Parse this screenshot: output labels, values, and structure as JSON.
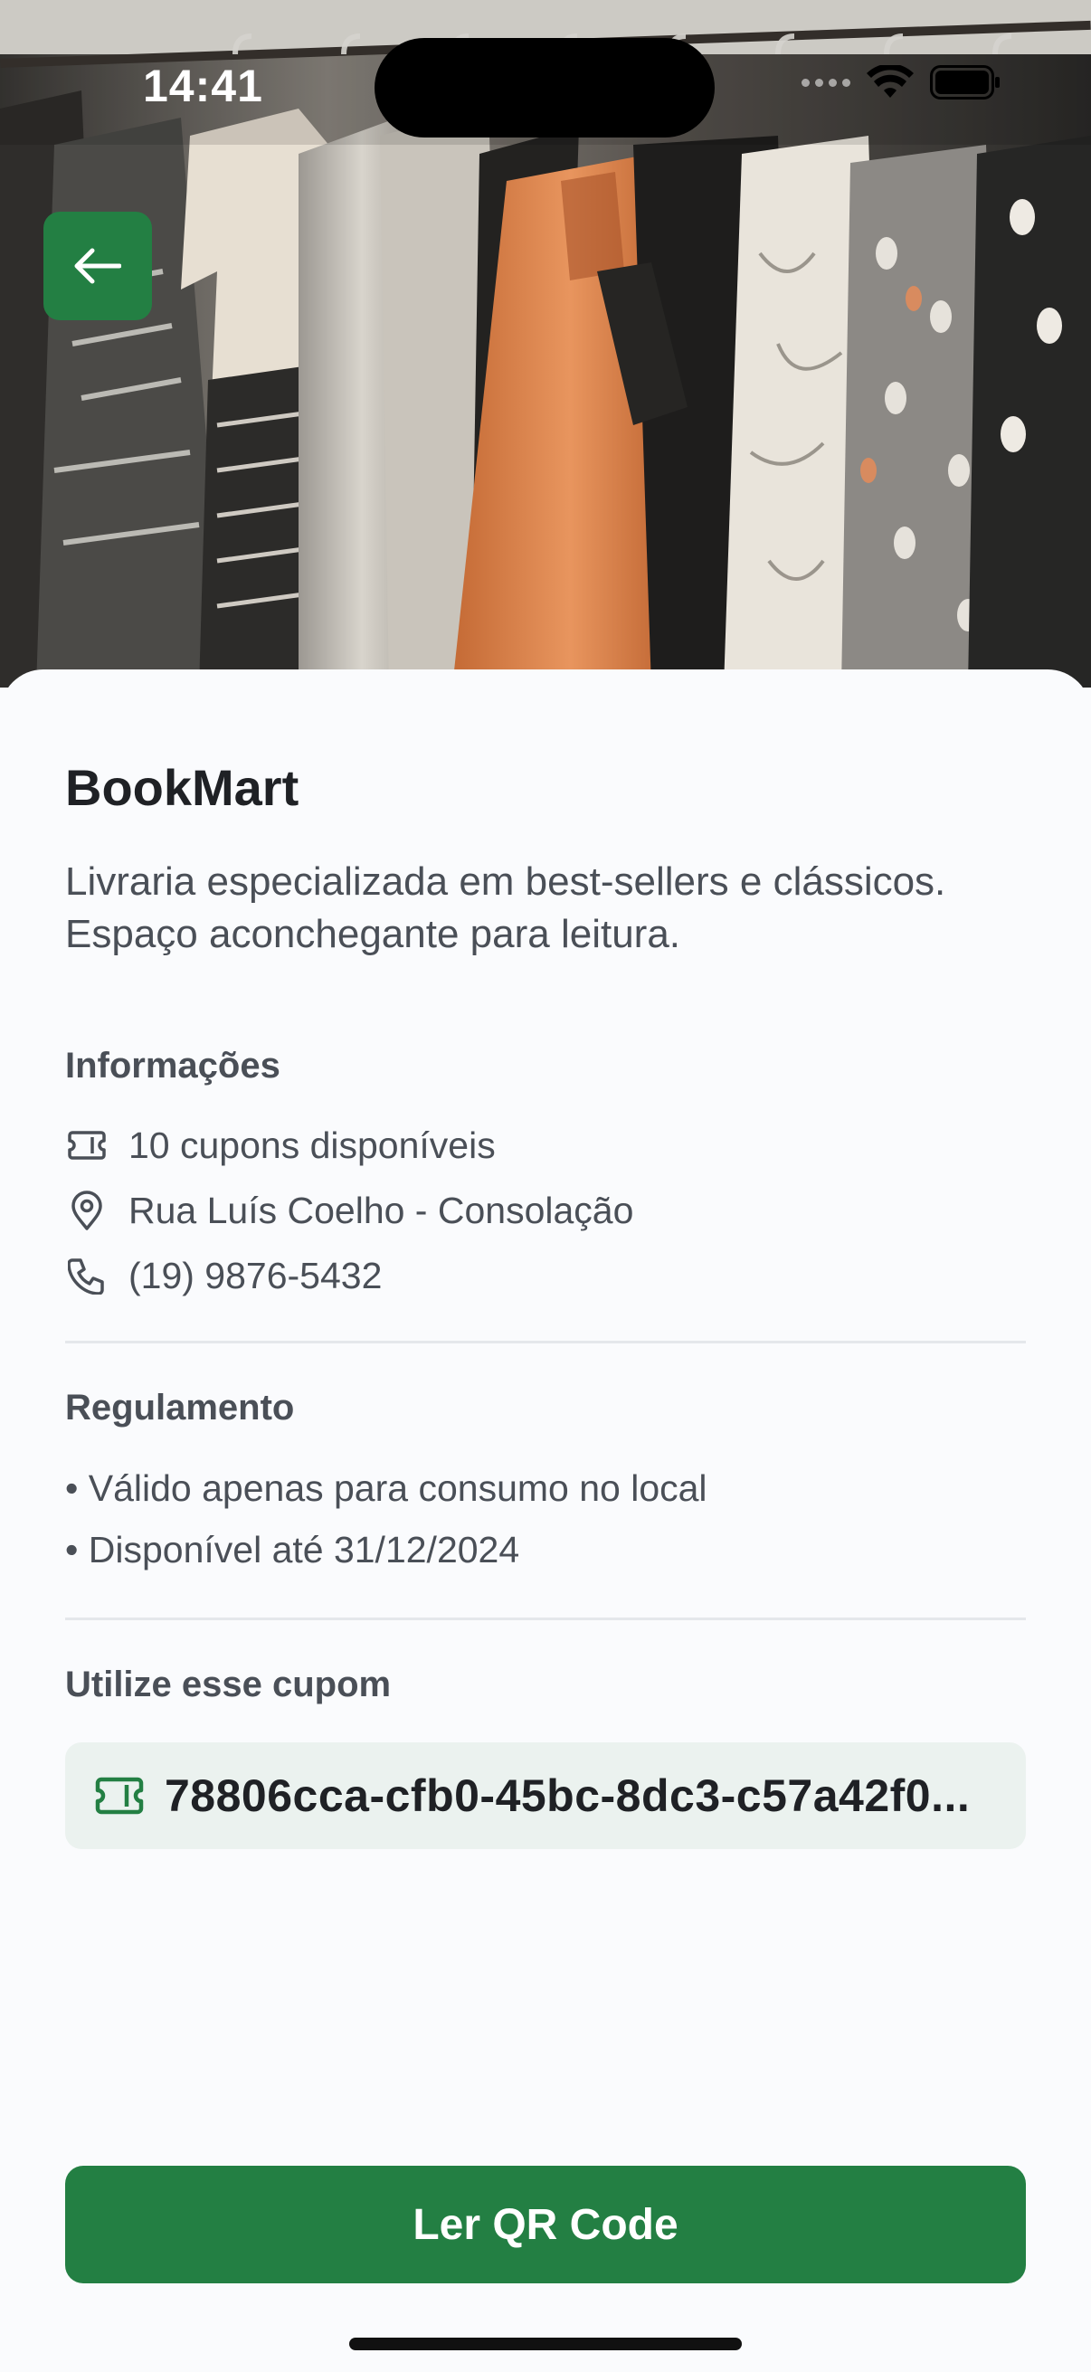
{
  "status_bar": {
    "time": "14:41",
    "icons": [
      "cellular-signal-icon",
      "wifi-icon",
      "battery-icon"
    ]
  },
  "hero": {
    "image": "clothing-rack-photo",
    "back_icon": "arrow-left-icon"
  },
  "store": {
    "name": "BookMart",
    "description": "Livraria especializada em best-sellers e clássicos. Espaço aconchegante para leitura."
  },
  "info": {
    "label": "Informações",
    "items": [
      {
        "icon": "ticket-icon",
        "text": "10 cupons disponíveis"
      },
      {
        "icon": "map-pin-icon",
        "text": "Rua Luís Coelho - Consolação"
      },
      {
        "icon": "phone-icon",
        "text": "(19) 9876-5432"
      }
    ]
  },
  "rules": {
    "label": "Regulamento",
    "items": [
      "• Válido apenas para consumo no local",
      "• Disponível até 31/12/2024"
    ]
  },
  "coupon": {
    "label": "Utilize esse cupom",
    "icon": "ticket-icon",
    "code": "78806cca-cfb0-45bc-8dc3-c57a42f0..."
  },
  "actions": {
    "read_qr_label": "Ler QR Code"
  },
  "colors": {
    "accent": "#237F43",
    "background": "#FAFBFD",
    "coupon_bg": "#EBF2EF",
    "text_primary": "#1F2125",
    "text_secondary": "#4A4F57"
  }
}
